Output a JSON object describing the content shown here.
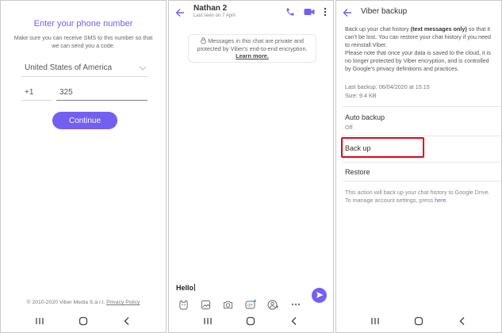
{
  "colors": {
    "accent": "#7360f2",
    "highlight": "#e30613"
  },
  "icons": {
    "nav_recent": "recent-apps-icon",
    "nav_home": "home-icon",
    "nav_back": "nav-back-icon",
    "back_arrow": "back-arrow-icon",
    "call": "phone-call-icon",
    "video": "video-call-icon",
    "more": "more-vert-icon",
    "send": "send-icon",
    "tools": [
      "sticker-icon",
      "gallery-icon",
      "camera-icon",
      "gif-icon",
      "add-contact-icon",
      "more-horiz-icon"
    ]
  },
  "registration": {
    "title": "Enter your phone number",
    "description": "Make sure you can receive SMS to this number so that we can send you a code.",
    "country": "United States of America",
    "country_code": "+1",
    "phone_number": "325",
    "continue_label": "Continue",
    "footer_text": "© 2010-2020 Viber Media S.à r.l.",
    "privacy_label": "Privacy Policy"
  },
  "chat": {
    "name": "Nathan 2",
    "last_seen": "Last seen on 7 April",
    "encryption_notice": "Messages in this chat are private and protected by Viber's end-to-end encryption.",
    "learn_more": "Learn more.",
    "input_text": "Hello"
  },
  "backup": {
    "title": "Viber backup",
    "desc_pre": "Back up your chat history ",
    "desc_bold": "(text messages only)",
    "desc_post": " so that it can't be lost. You can restore your chat history if you need to reinstall Viber.",
    "desc2": "Please note that once your data is saved to the cloud, it is no longer protected by Viber encryption, and is controlled by Google's privacy definitions and practices.",
    "last_backup": "Last backup: 06/04/2020 at 15:15",
    "size": "Size: 9.4 KB",
    "auto_backup_label": "Auto backup",
    "auto_backup_value": "Off",
    "back_up_label": "Back up",
    "restore_label": "Restore",
    "note_pre": "This action will back up your chat history to Google Drive. To manage account settings, press ",
    "note_link": "here",
    "note_post": "."
  }
}
